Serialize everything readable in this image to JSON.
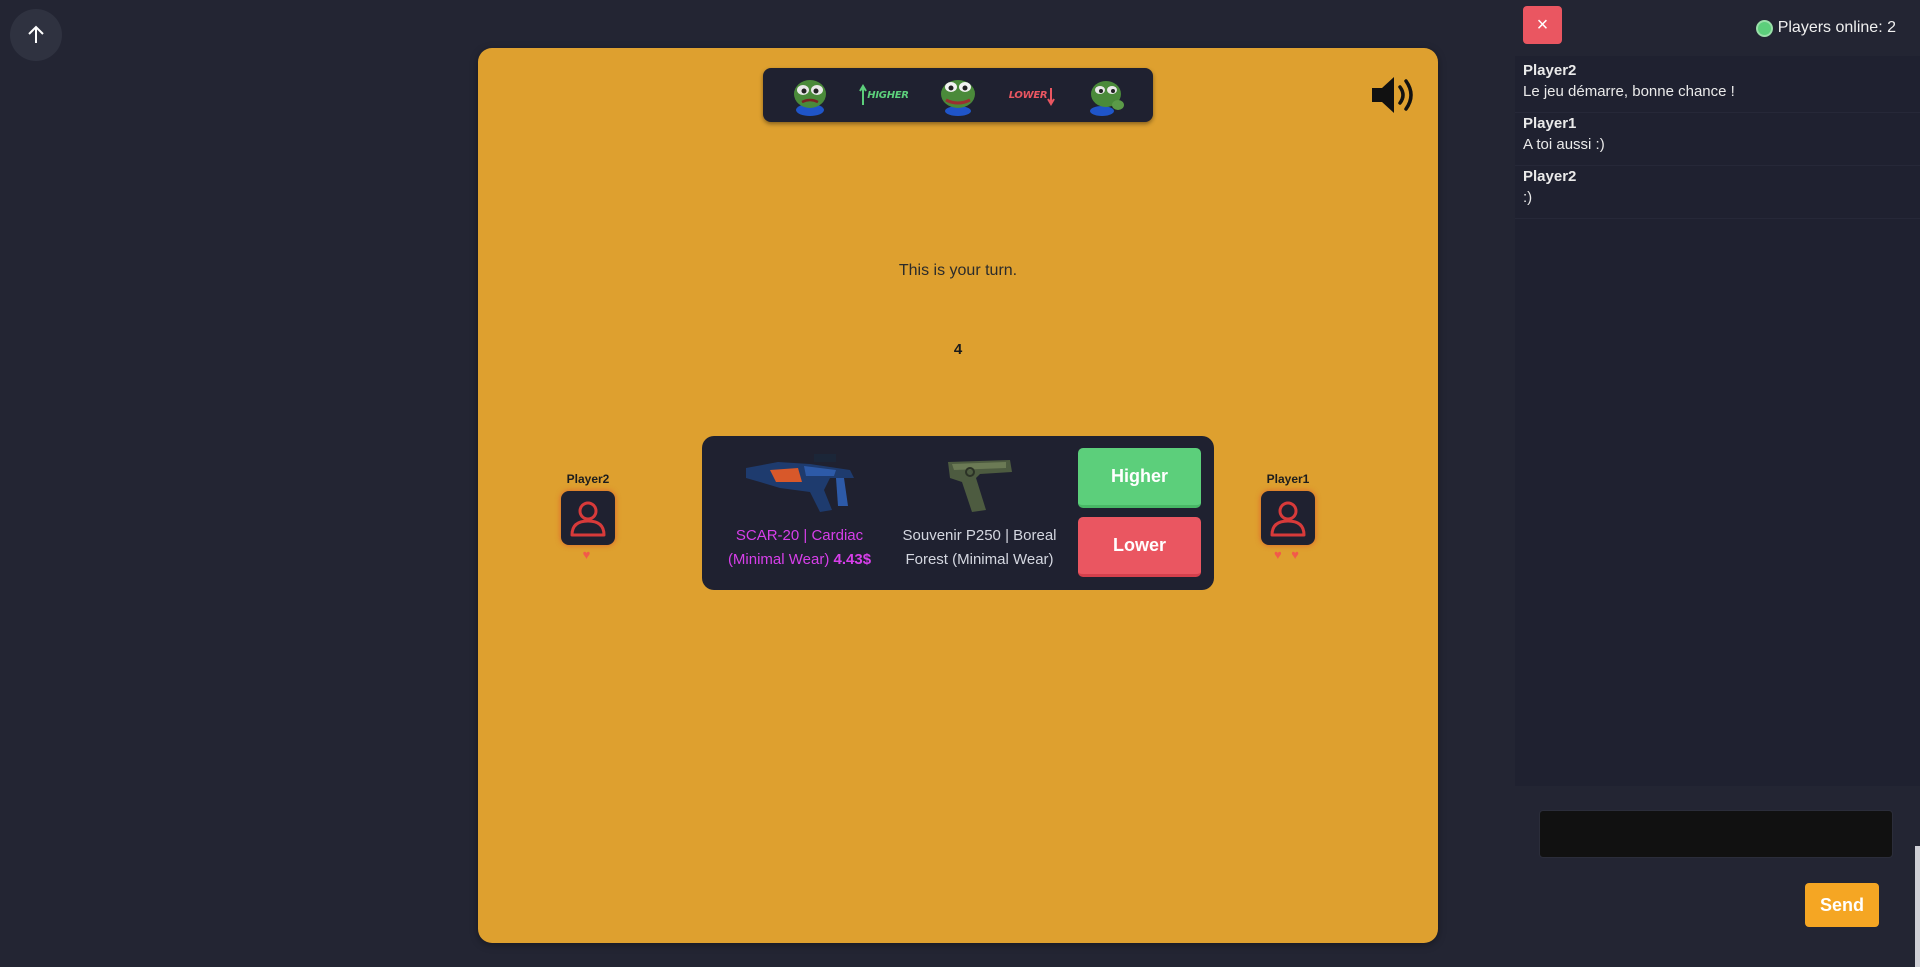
{
  "scroll_top": {
    "icon": "arrow-up-icon"
  },
  "emotes": [
    {
      "name": "pepe-cry-icon"
    },
    {
      "name": "higher-emote",
      "label": "HIGHER",
      "color": "#5ccf7b"
    },
    {
      "name": "pepe-smile-icon"
    },
    {
      "name": "lower-emote",
      "label": "LOWER",
      "color": "#ea5661"
    },
    {
      "name": "pepe-think-icon"
    }
  ],
  "game": {
    "turn_text": "This is your turn.",
    "counter": "4",
    "left_player": {
      "name": "Player2",
      "lives": "♥"
    },
    "right_player": {
      "name": "Player1",
      "lives": "♥ ♥"
    },
    "item1": {
      "name": "SCAR-20 | Cardiac (Minimal Wear)",
      "price": "4.43$"
    },
    "item2": {
      "name": "Souvenir P250 | Boreal Forest (Minimal Wear)"
    },
    "higher_label": "Higher",
    "lower_label": "Lower"
  },
  "chat": {
    "close_label": "×",
    "online_text": "Players online: 2",
    "messages": [
      {
        "user": "Player2",
        "text": "Le jeu démarre, bonne chance !"
      },
      {
        "user": "Player1",
        "text": "A toi aussi :)"
      },
      {
        "user": "Player2",
        "text": ":)"
      }
    ],
    "input_value": "",
    "send_label": "Send"
  },
  "colors": {
    "panel": "#dea02f",
    "background": "#232533",
    "card": "#1f2130",
    "higher": "#5ccf7b",
    "lower": "#ea5661",
    "item_rarity": "#d73fea",
    "send": "#f5a623"
  }
}
